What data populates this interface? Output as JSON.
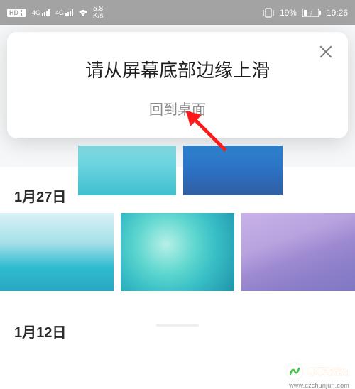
{
  "status": {
    "hd": "HD",
    "net_label_1": "4G",
    "net_label_2": "4G",
    "speed_top": "5.8",
    "speed_bot": "K/s",
    "battery_pct": "19%",
    "time": "19:26"
  },
  "dialog": {
    "title": "请从屏幕底部边缘上滑",
    "subtitle": "回到桌面"
  },
  "sections": {
    "date1": "1月27日",
    "date2": "1月12日"
  },
  "watermark": {
    "text": "春军游戏网",
    "url": "www.czchunjun.com"
  }
}
